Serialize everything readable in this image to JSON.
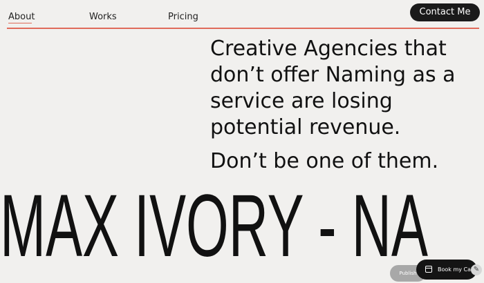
{
  "nav": {
    "items": [
      {
        "label": "About"
      },
      {
        "label": "Works"
      },
      {
        "label": "Pricing"
      }
    ],
    "cta_label": "Contact Me"
  },
  "hero": {
    "headline_lines": [
      "Creative Agencies that",
      "don’t offer Naming as a",
      "service are losing",
      "potential revenue."
    ],
    "subline": "Don’t be one of them.",
    "marquee": "MAX IVORY - NA"
  },
  "widgets": {
    "publish_label": "Publish",
    "book_label": "Book my Cal",
    "book_icon": "calendar-icon",
    "edit_icon": "pencil-icon"
  },
  "colors": {
    "background": "#f1f0ee",
    "accent_rule": "#e06a5a",
    "button_dark": "#1a1a1a"
  }
}
